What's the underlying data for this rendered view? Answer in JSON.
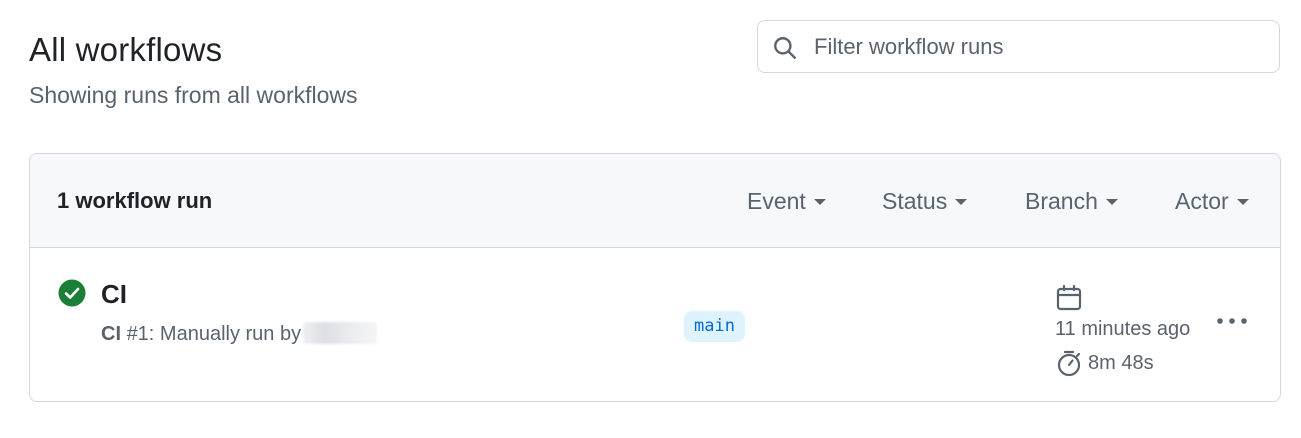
{
  "header": {
    "title": "All workflows",
    "subtitle": "Showing runs from all workflows"
  },
  "search": {
    "placeholder": "Filter workflow runs",
    "value": "",
    "icon": "search-icon"
  },
  "runs": {
    "count_label": "1 workflow run",
    "filters": [
      {
        "label": "Event"
      },
      {
        "label": "Status"
      },
      {
        "label": "Branch"
      },
      {
        "label": "Actor"
      }
    ],
    "items": [
      {
        "status": "success",
        "status_icon": "check-circle-fill-icon",
        "title": "CI",
        "workflow_name": "CI",
        "run_description": "#1: Manually run by",
        "branch": "main",
        "time_ago": "11 minutes ago",
        "duration": "8m 48s"
      }
    ]
  },
  "colors": {
    "success": "#1a7f37",
    "muted_text": "#59636e",
    "border": "#d1d9e0",
    "header_bg": "#f6f8fa",
    "branch_bg": "#ddf4ff",
    "branch_text": "#0969da"
  }
}
